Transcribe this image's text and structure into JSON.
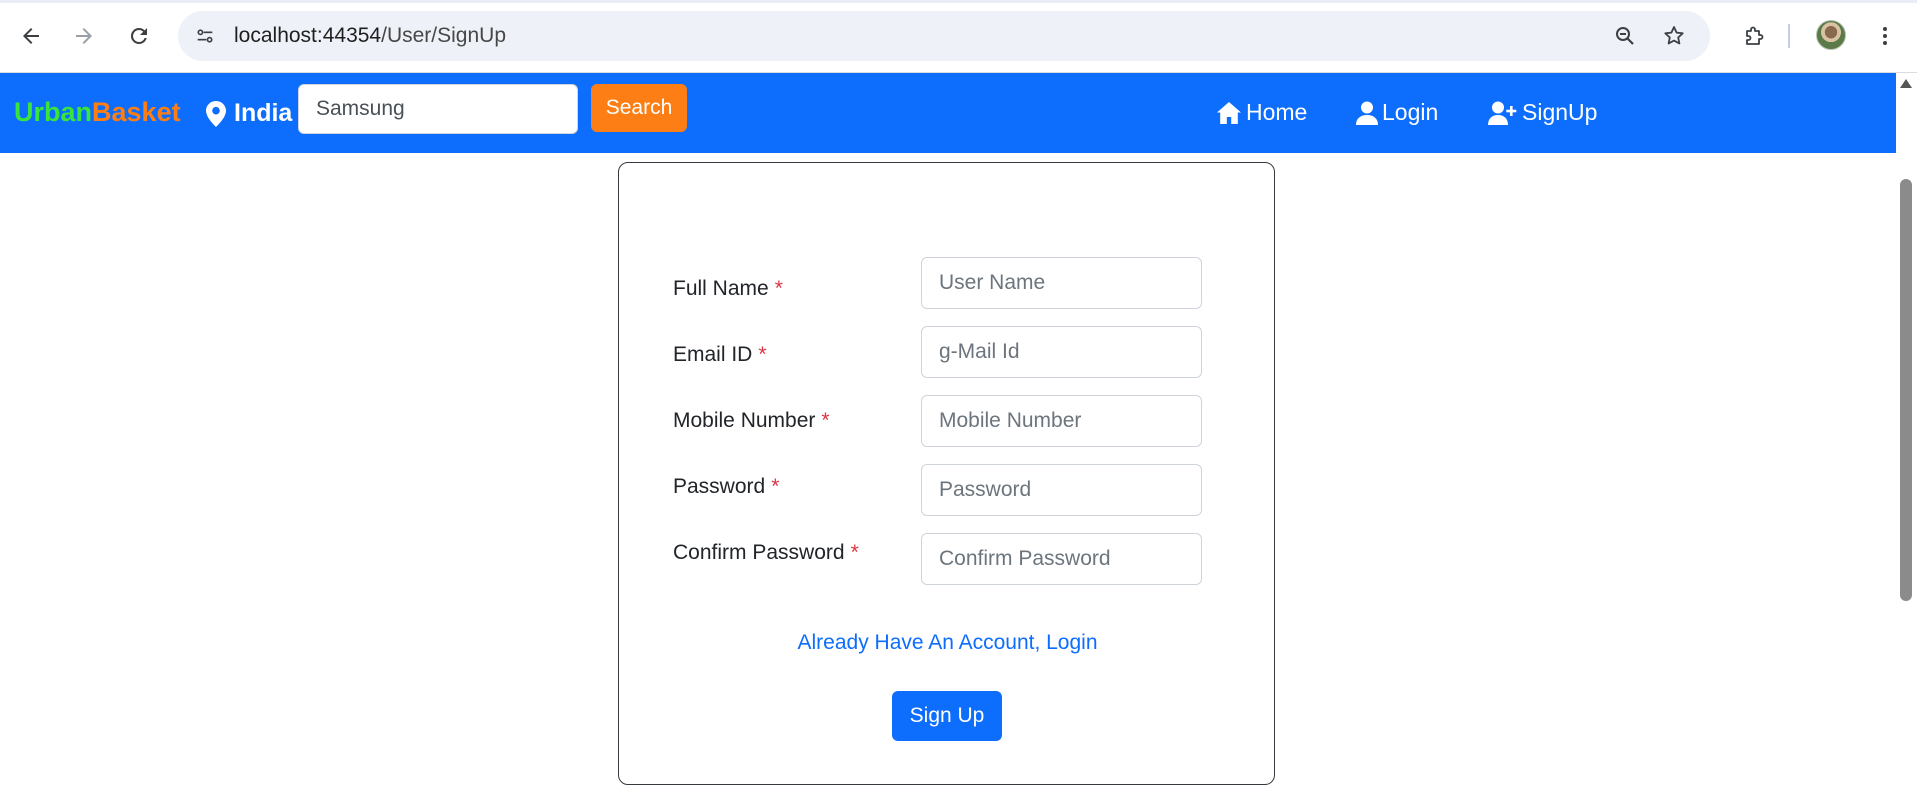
{
  "browser": {
    "url_host": "localhost:44354",
    "url_path": "/User/SignUp"
  },
  "navbar": {
    "brand_part1": "Urban",
    "brand_part2": "Basket",
    "location": "India",
    "search_value": "Samsung",
    "search_button": "Search",
    "links": {
      "home": "Home",
      "login": "Login",
      "signup": "SignUp"
    }
  },
  "form": {
    "required_marker": "*",
    "fields": [
      {
        "label": "Full Name",
        "placeholder": "User Name"
      },
      {
        "label": "Email ID",
        "placeholder": "g-Mail Id"
      },
      {
        "label": "Mobile Number",
        "placeholder": "Mobile Number"
      },
      {
        "label": "Password",
        "placeholder": "Password"
      },
      {
        "label": "Confirm Password",
        "placeholder": "Confirm Password"
      }
    ],
    "login_link": "Already Have An Account, Login",
    "submit_button": "Sign Up"
  },
  "colors": {
    "navbar": "#0d6efd",
    "brand_green": "#39e43c",
    "brand_orange": "#fd7e14",
    "search_button": "#fd7e14",
    "required": "#dc3545"
  }
}
